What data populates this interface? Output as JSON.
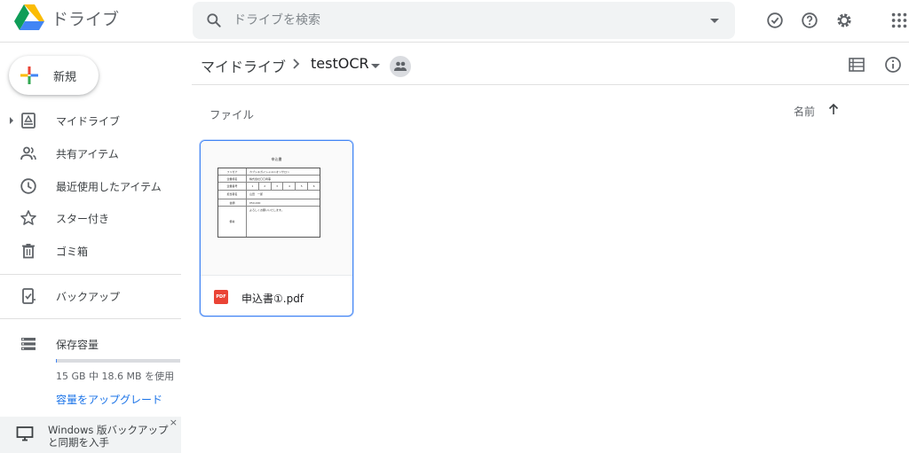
{
  "app": {
    "name": "ドライブ",
    "colors": {
      "accent": "#1a73e8",
      "selection": "#4285f4",
      "pdf": "#ea4335"
    }
  },
  "header": {
    "search_placeholder": "ドライブを検索",
    "icons": [
      "search-icon",
      "chevron-down-icon",
      "offline-check-icon",
      "help-icon",
      "settings-icon",
      "apps-grid-icon"
    ]
  },
  "sidebar": {
    "new_label": "新規",
    "items": [
      {
        "label": "マイドライブ",
        "icon": "my-drive-icon"
      },
      {
        "label": "共有アイテム",
        "icon": "shared-people-icon"
      },
      {
        "label": "最近使用したアイテム",
        "icon": "clock-icon"
      },
      {
        "label": "スター付き",
        "icon": "star-icon"
      },
      {
        "label": "ゴミ箱",
        "icon": "trash-icon"
      },
      {
        "label": "バックアップ",
        "icon": "backup-icon"
      },
      {
        "label": "保存容量",
        "icon": "storage-icon"
      }
    ],
    "storage": {
      "usage_text": "15 GB 中 18.6 MB を使用",
      "used_fraction": 0.0012,
      "upgrade_label": "容量をアップグレード"
    },
    "promo": {
      "text": "Windows 版バックアップと同期を入手",
      "close": "×"
    }
  },
  "main": {
    "breadcrumb": [
      "マイドライブ",
      "testOCR"
    ],
    "section_label": "ファイル",
    "sort_label": "名前",
    "files": [
      {
        "name": "申込書①.pdf",
        "type_badge": "PDF",
        "preview": {
          "title": "申込書",
          "rows": [
            {
              "label": "フリガナ",
              "value": "カブシキガイシャユニオンサロン"
            },
            {
              "label": "企業様名",
              "value": "株式会社〇〇商事"
            },
            {
              "label": "企業番号",
              "cells": [
                "1",
                "2",
                "3",
                "4",
                "5",
                "6"
              ]
            },
            {
              "label": "担当者名",
              "value": "山田　一郎"
            },
            {
              "label": "金額",
              "value": "¥50,000"
            },
            {
              "label": "備考",
              "value": "よろしくお願いいたします。"
            }
          ]
        }
      }
    ]
  }
}
